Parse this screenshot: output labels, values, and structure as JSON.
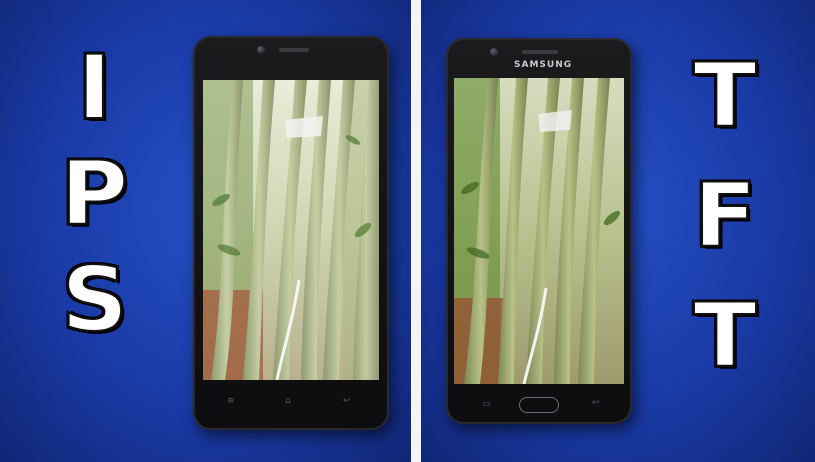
{
  "left_panel": {
    "letters": [
      "I",
      "P",
      "S"
    ]
  },
  "right_panel": {
    "letters": [
      "T",
      "F",
      "T"
    ],
    "phone_brand": "SAMSUNG"
  },
  "colors": {
    "background_blue": "#1a3aa6",
    "divider": "#f4f4f4",
    "phone_body": "#141416",
    "letter_fill": "#ffffff",
    "letter_outline": "#111111"
  }
}
